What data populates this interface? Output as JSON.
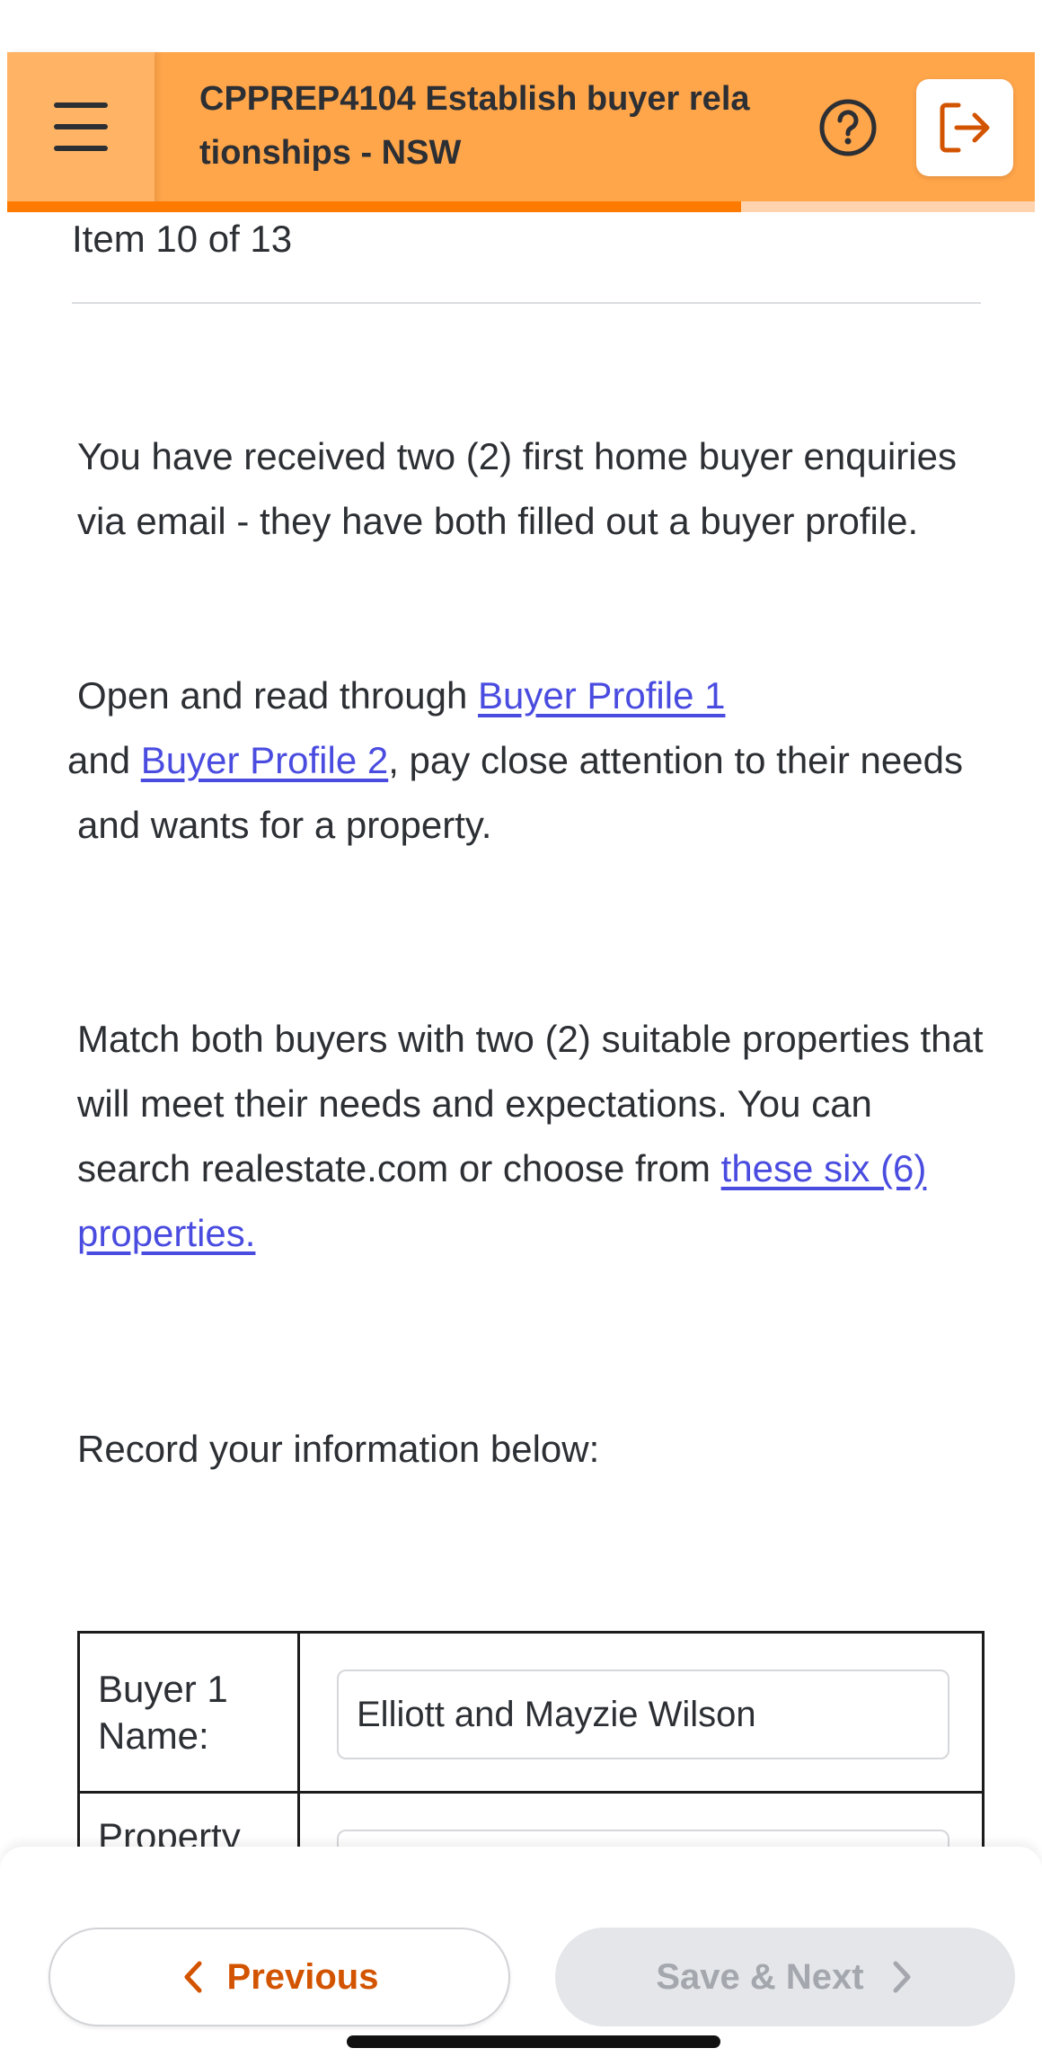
{
  "header": {
    "title": "CPPREP4104 Establish buyer relationships - NSW",
    "menu_icon": "hamburger-menu-icon",
    "help_icon": "help-circle-icon",
    "exit_icon": "exit-icon",
    "progress": 0.714,
    "accent": "#ffa54a",
    "progress_color": "#ff7a00"
  },
  "item_counter": "Item 10 of 13",
  "content": {
    "p1": "You have received two (2) first home buyer enquiries via email - they have both filled out a buyer profile.",
    "p2_pre": "Open and read through ",
    "p2_link1": "Buyer Profile 1",
    "p2_mid": " and ",
    "p2_link2": "Buyer Profile 2",
    "p2_post": ", pay close attention to their needs and wants for a property.",
    "p3_pre": "Match both buyers with two (2) suitable properties that will meet their needs and expectations. You can search realestate.com or choose from ",
    "p3_link": "these six (6) properties.",
    "p4": "Record your information below:",
    "link_color": "#4a4ce0"
  },
  "table": {
    "row1_label": "Buyer 1 Name:",
    "row1_value": "Elliott and Mayzie Wilson",
    "row2_label": "Property"
  },
  "nav": {
    "previous": "Previous",
    "save_next": "Save & Next",
    "previous_color": "#d35400"
  }
}
